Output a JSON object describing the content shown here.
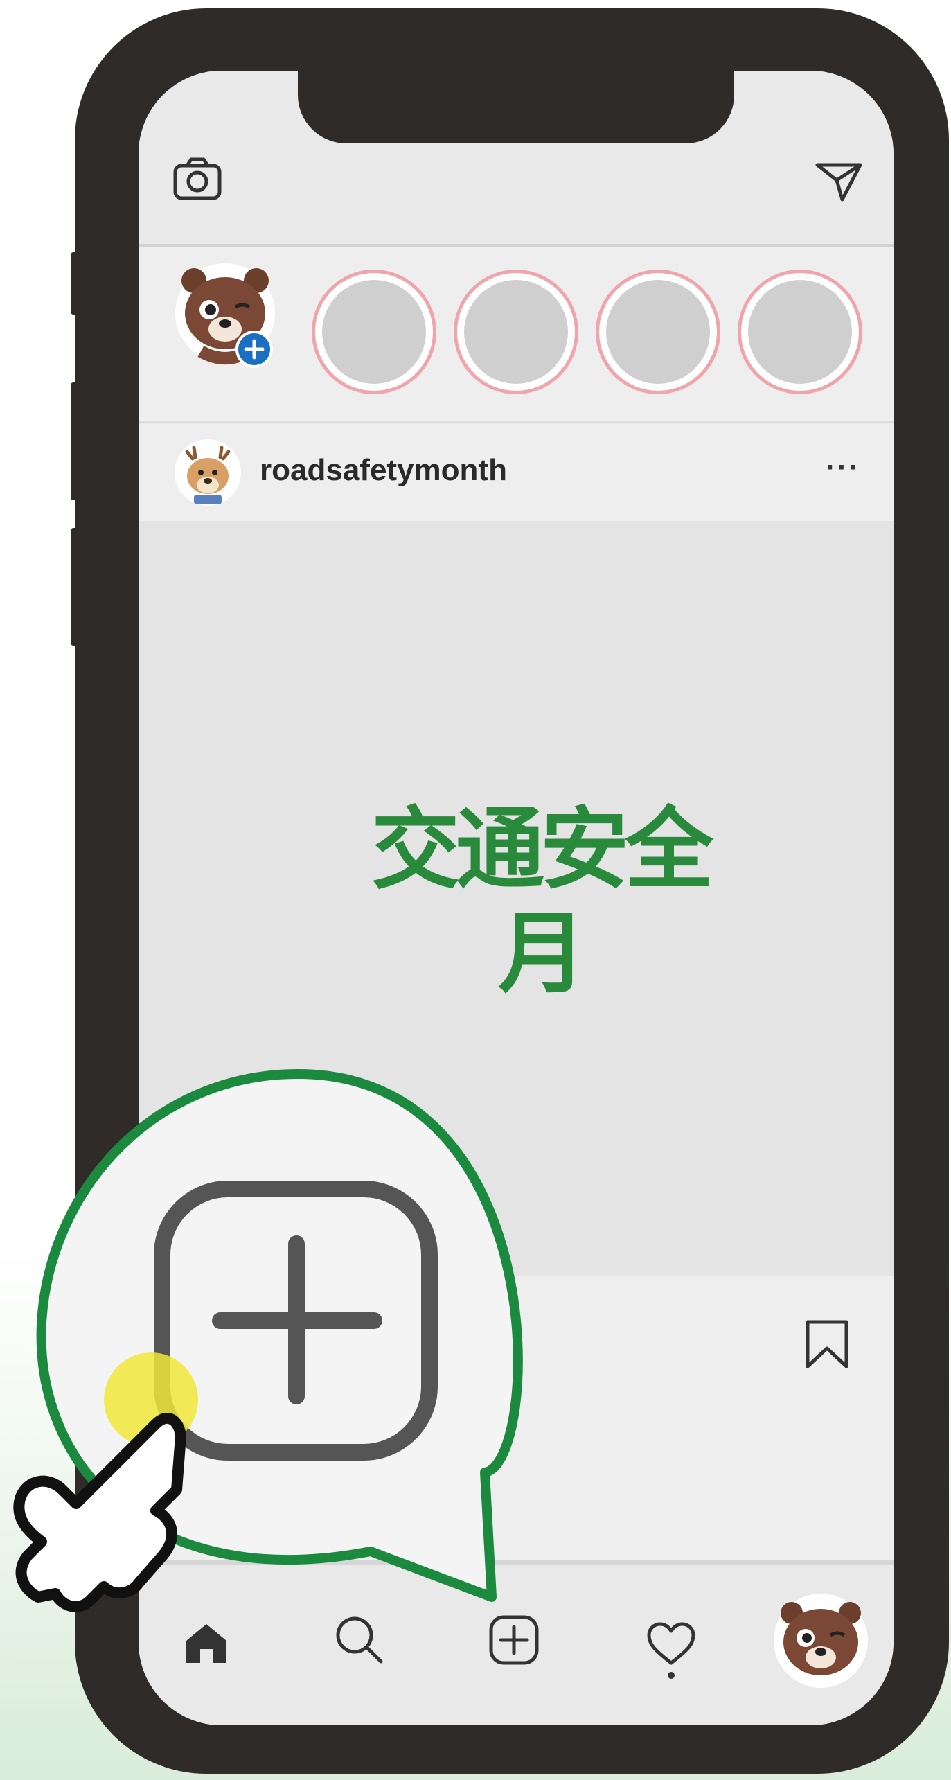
{
  "post": {
    "username": "roadsafetymonth",
    "more_label": "···",
    "image_text": "交通安全月"
  },
  "colors": {
    "phone_frame": "#2e2b29",
    "story_ring": "#f0a5ab",
    "highlight_green": "#1c8a3e",
    "tap_yellow": "#f1e63a",
    "add_badge_blue": "#1a6fc0",
    "title_green": "#2a8a3c"
  },
  "icons": {
    "top_left": "camera-icon",
    "top_right": "direct-message-icon",
    "bookmark": "bookmark-icon",
    "nav": [
      "home-icon",
      "search-icon",
      "add-post-icon",
      "activity-heart-icon",
      "profile-avatar"
    ],
    "zoom_callout": "add-post-icon",
    "pointer": "pointing-hand-icon"
  }
}
